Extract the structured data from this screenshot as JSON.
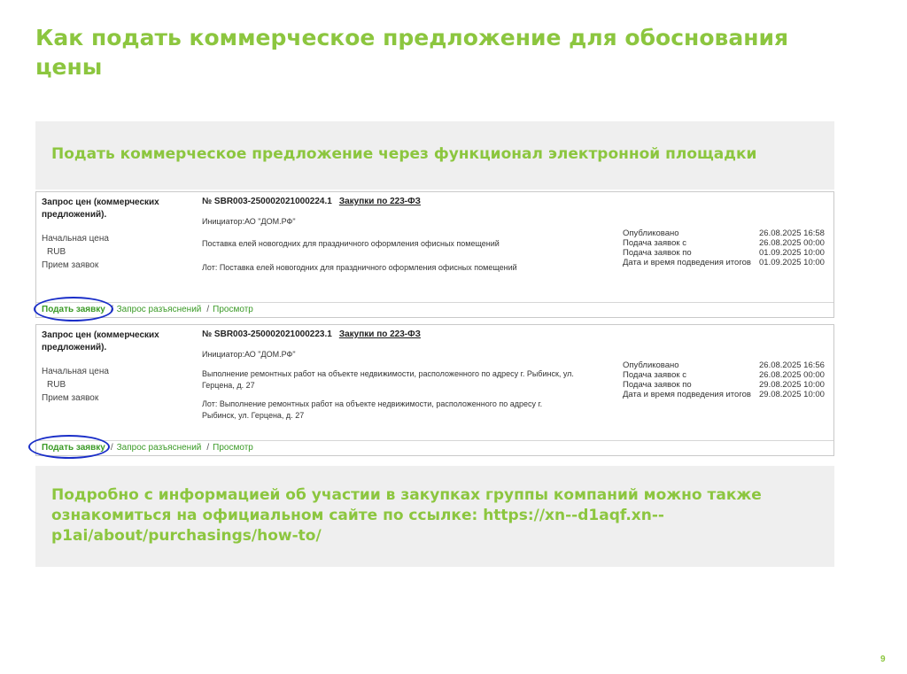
{
  "title": "Как подать коммерческое предложение для обоснования цены",
  "subtitle": "Подать коммерческое предложение через функционал электронной площадки",
  "cards": [
    {
      "proc_type": "Запрос цен (коммерческих предложений).",
      "start_price_label": "Начальная цена",
      "currency": "RUB",
      "acceptance_label": "Прием заявок",
      "number": "№ SBR003-250002021000224.1",
      "law": "Закупки по 223-ФЗ",
      "initiator": "Инициатор:АО \"ДОМ.РФ\"",
      "subject": "Поставка елей новогодних для праздничного оформления офисных помещений",
      "lot": "Лот: Поставка елей новогодних для праздничного оформления офисных помещений",
      "meta": [
        {
          "label": "Опубликовано",
          "value": "26.08.2025 16:58"
        },
        {
          "label": "Подача заявок с",
          "value": "26.08.2025 00:00"
        },
        {
          "label": "Подача заявок по",
          "value": "01.09.2025 10:00"
        },
        {
          "label": "Дата и время подведения итогов",
          "value": "01.09.2025 10:00"
        }
      ],
      "actions": {
        "apply": "Подать заявку",
        "clarify": "Запрос разъяснений",
        "view": "Просмотр",
        "sep": "/"
      }
    },
    {
      "proc_type": "Запрос цен (коммерческих предложений).",
      "start_price_label": "Начальная цена",
      "currency": "RUB",
      "acceptance_label": "Прием заявок",
      "number": "№ SBR003-250002021000223.1",
      "law": "Закупки по 223-ФЗ",
      "initiator": "Инициатор:АО \"ДОМ.РФ\"",
      "subject_line1": "Выполнение ремонтных работ на объекте недвижимости, расположенного по адресу г. Рыбинск, ул.",
      "subject_line2": "Герцена, д. 27",
      "lot_line1": "Лот: Выполнение ремонтных работ на объекте недвижимости, расположенного по адресу г.",
      "lot_line2": "Рыбинск, ул. Герцена, д. 27",
      "meta": [
        {
          "label": "Опубликовано",
          "value": "26.08.2025 16:56"
        },
        {
          "label": "Подача заявок с",
          "value": "26.08.2025 00:00"
        },
        {
          "label": "Подача заявок по",
          "value": "29.08.2025 10:00"
        },
        {
          "label": "Дата и время подведения итогов",
          "value": "29.08.2025 10:00"
        }
      ],
      "actions": {
        "apply": "Подать заявку",
        "clarify": "Запрос разъяснений",
        "view": "Просмотр",
        "sep": "/"
      }
    }
  ],
  "info": "Подробно с информацией об участии в закупках группы компаний можно также ознакомиться на официальном сайте по ссылке: https://xn--d1aqf.xn--p1ai/about/purchasings/how-to/",
  "page_number": "9",
  "colors": {
    "accent": "#8cc63f",
    "link": "#3a9a26",
    "highlight_ring": "#1a2ec8",
    "band": "#efefef"
  }
}
